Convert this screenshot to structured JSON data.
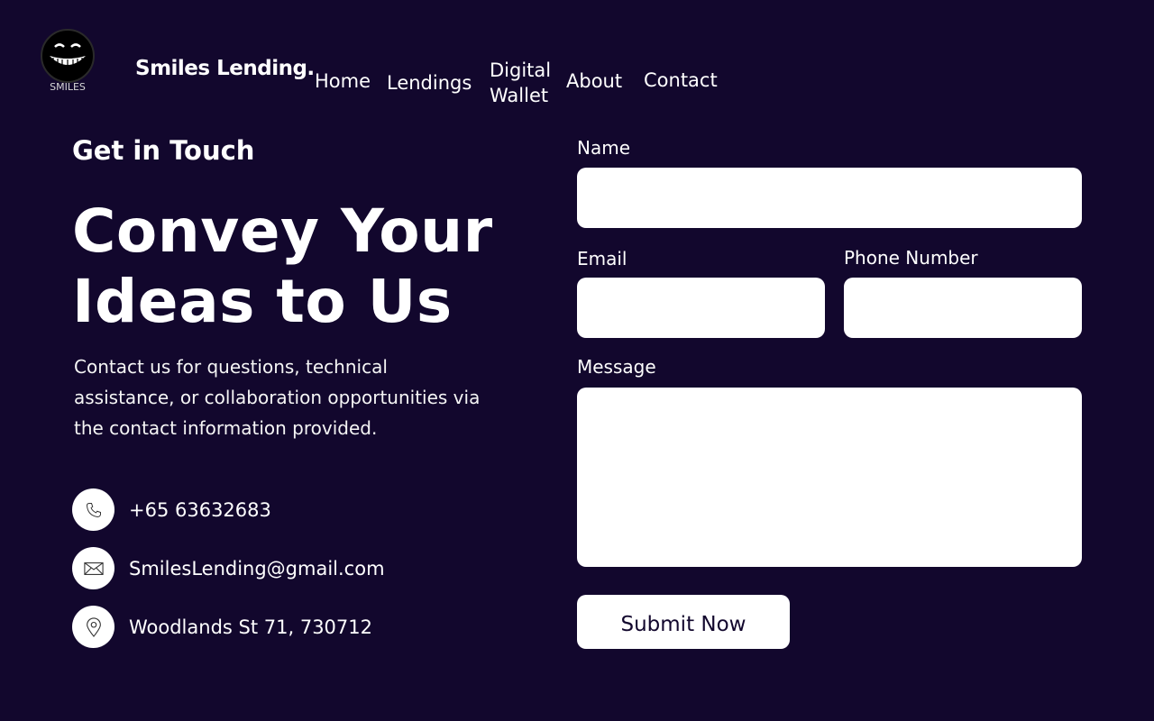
{
  "header": {
    "logo_text": "SMILES",
    "brand": "Smiles Lending.",
    "nav": [
      "Home",
      "Lendings",
      "Digital Wallet",
      "About",
      "Contact"
    ]
  },
  "hero": {
    "kicker": "Get in Touch",
    "headline": "Convey Your Ideas to Us",
    "lead": "Contact us for questions, technical assistance, or collaboration opportunities via the contact information provided."
  },
  "contacts": {
    "phone": "+65 63632683",
    "email": "SmilesLending@gmail.com",
    "address": "Woodlands St 71, 730712"
  },
  "form": {
    "name_label": "Name",
    "email_label": "Email",
    "phone_label": "Phone Number",
    "message_label": "Message",
    "name_value": "",
    "email_value": "",
    "phone_value": "",
    "message_value": "",
    "submit_label": "Submit Now"
  },
  "colors": {
    "background": "#12072d",
    "text": "#ffffff",
    "field_bg": "#ffffff"
  },
  "icons": [
    "smile-logo",
    "phone-icon",
    "mail-icon",
    "location-pin-icon"
  ]
}
